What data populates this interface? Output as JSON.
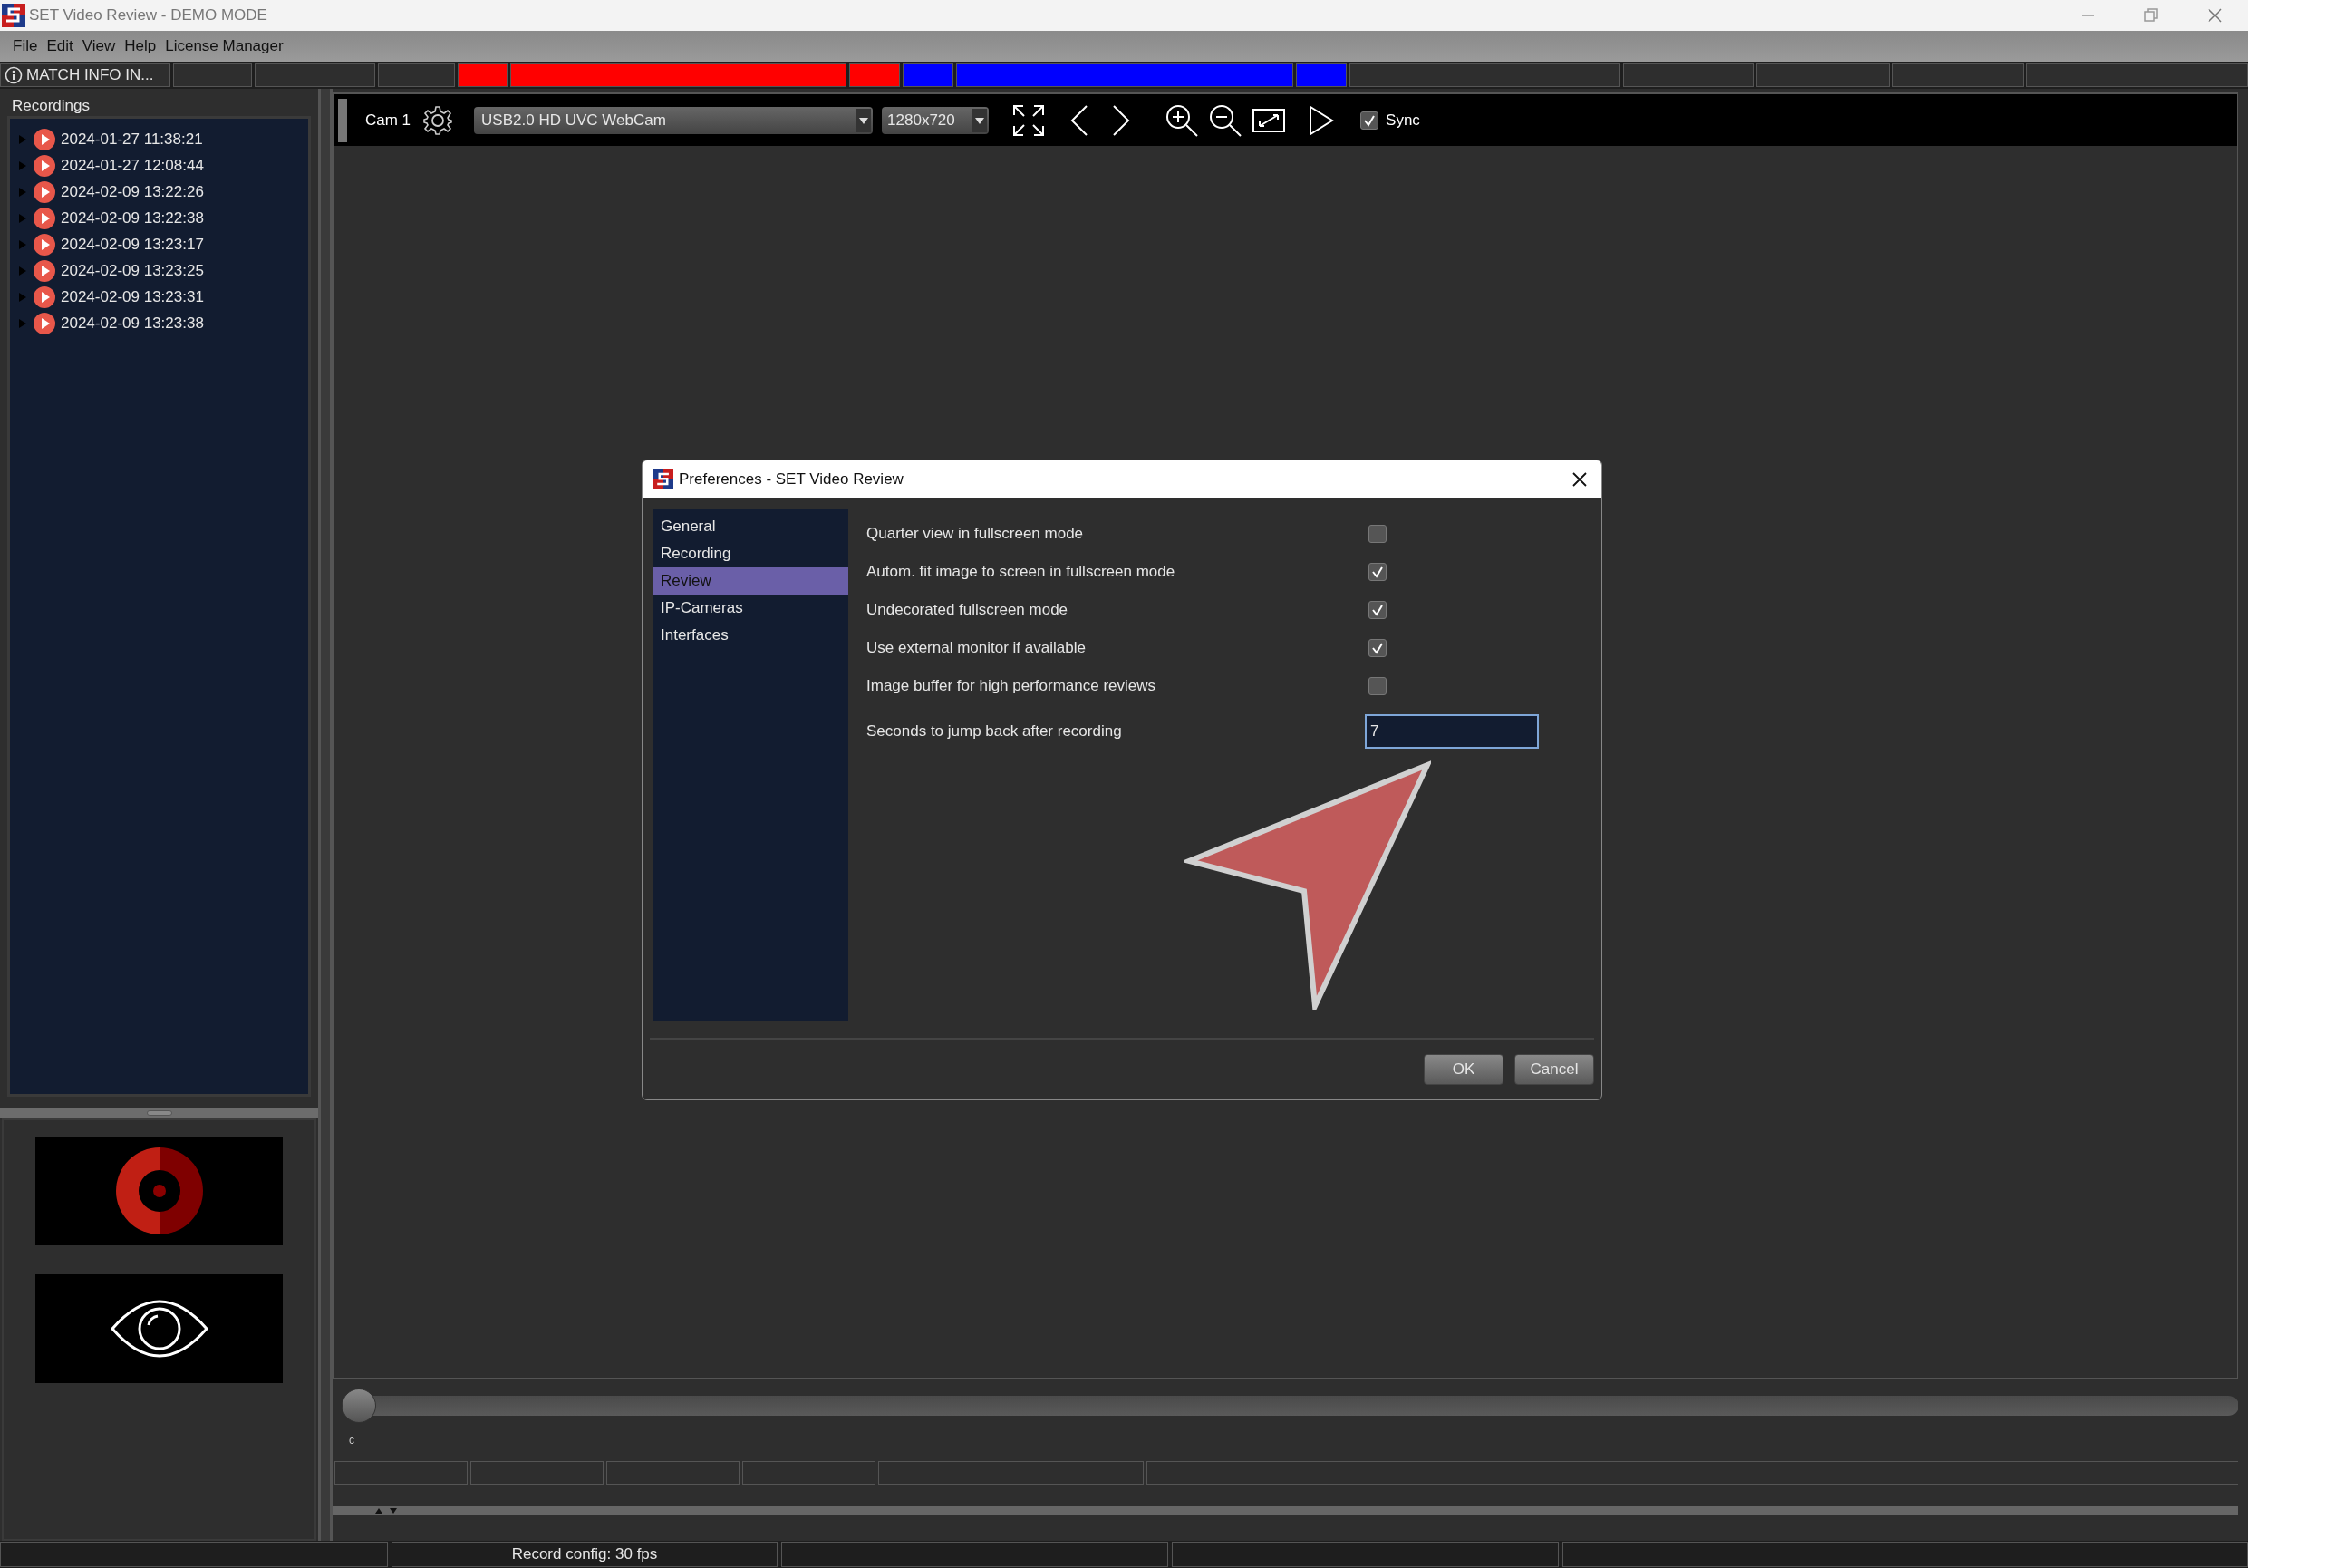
{
  "window": {
    "title": "SET Video Review - DEMO MODE"
  },
  "menu": [
    {
      "label": "File"
    },
    {
      "label": "Edit"
    },
    {
      "label": "View"
    },
    {
      "label": "Help"
    },
    {
      "label": "License Manager"
    }
  ],
  "match_bar": {
    "label": "MATCH INFO IN...",
    "segments": [
      {
        "color": "#2e2e2e"
      },
      {
        "color": "#2e2e2e"
      },
      {
        "color": "#2e2e2e"
      },
      {
        "color": "#ff0000"
      },
      {
        "color": "#ff0000"
      },
      {
        "color": "#ff0000"
      },
      {
        "color": "#0000ff"
      },
      {
        "color": "#0000ff"
      },
      {
        "color": "#0000ff"
      },
      {
        "color": "#2e2e2e"
      },
      {
        "color": "#2e2e2e"
      },
      {
        "color": "#2e2e2e"
      },
      {
        "color": "#2e2e2e"
      },
      {
        "color": "#2e2e2e"
      }
    ]
  },
  "recordings": {
    "title": "Recordings",
    "items": [
      {
        "label": "2024-01-27 11:38:21",
        "expanded": false
      },
      {
        "label": "2024-01-27 12:08:44",
        "expanded": false
      },
      {
        "label": "2024-02-09 13:22:26",
        "expanded": false
      },
      {
        "label": "2024-02-09 13:22:38",
        "expanded": false
      },
      {
        "label": "2024-02-09 13:23:17",
        "expanded": false
      },
      {
        "label": "2024-02-09 13:23:25",
        "expanded": false
      },
      {
        "label": "2024-02-09 13:23:31",
        "expanded": false
      },
      {
        "label": "2024-02-09 13:23:38",
        "expanded": false
      }
    ]
  },
  "camera": {
    "label": "Cam 1",
    "source": "USB2.0 HD UVC WebCam",
    "resolution": "1280x720",
    "sync": {
      "label": "Sync",
      "checked": true
    }
  },
  "timeline": {
    "level": 0,
    "tick_label": "c"
  },
  "status_bar": {
    "text": "Record config: 30 fps"
  },
  "dialog": {
    "title": "Preferences - SET Video Review",
    "nav": [
      {
        "label": "General",
        "selected": false
      },
      {
        "label": "Recording",
        "selected": false
      },
      {
        "label": "Review",
        "selected": true
      },
      {
        "label": "IP-Cameras",
        "selected": false
      },
      {
        "label": "Interfaces",
        "selected": false
      }
    ],
    "settings": [
      {
        "kind": "checkbox",
        "label": "Quarter view in fullscreen mode",
        "checked": false
      },
      {
        "kind": "checkbox",
        "label": "Autom. fit image to screen in fullscreen mode",
        "checked": true
      },
      {
        "kind": "checkbox",
        "label": "Undecorated fullscreen mode",
        "checked": true
      },
      {
        "kind": "checkbox",
        "label": "Use external monitor if available",
        "checked": true
      },
      {
        "kind": "checkbox",
        "label": "Image buffer for high performance reviews",
        "checked": false
      },
      {
        "kind": "number",
        "label": "Seconds to jump back after recording",
        "value": "7"
      }
    ],
    "buttons": [
      {
        "label": "OK"
      },
      {
        "label": "Cancel"
      }
    ]
  }
}
